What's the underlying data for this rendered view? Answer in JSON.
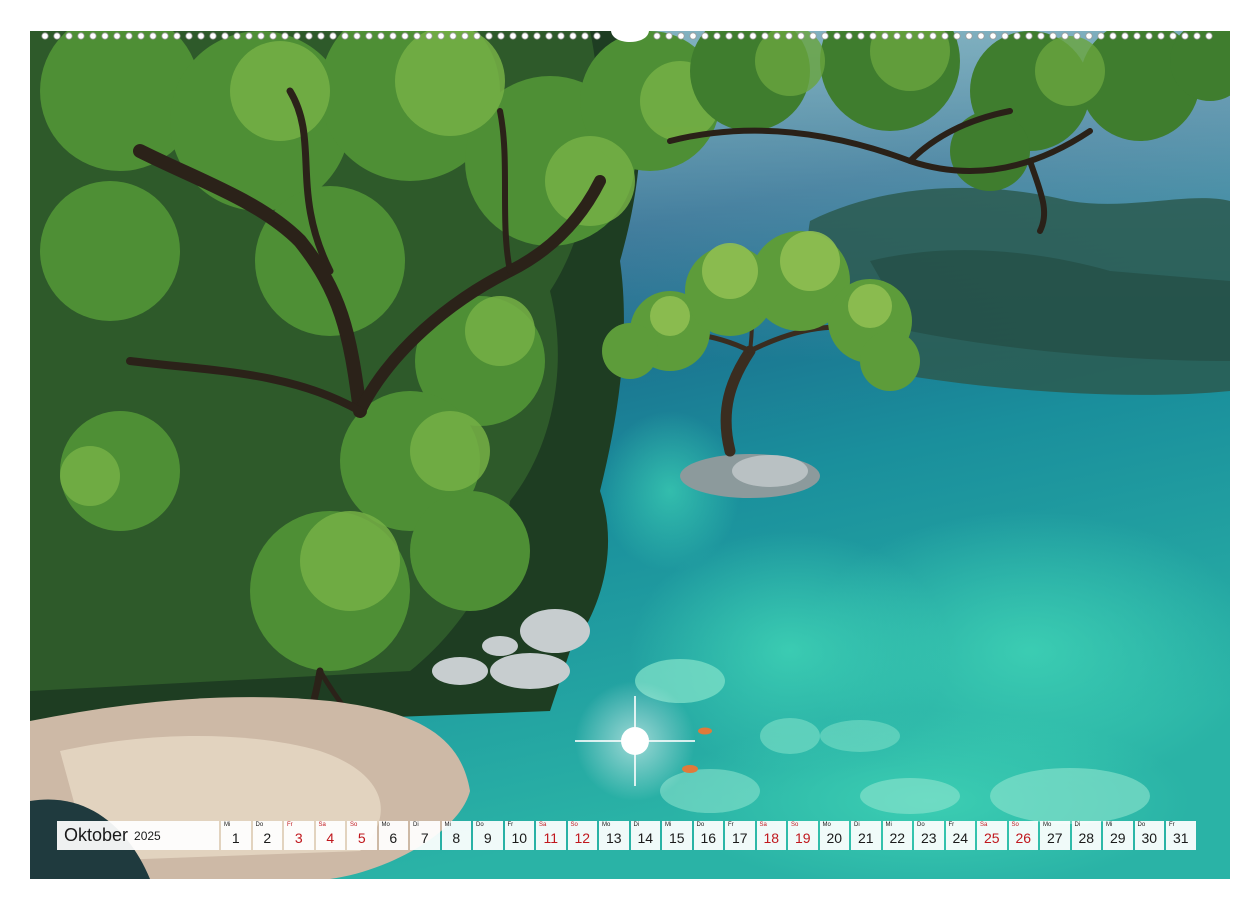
{
  "calendar": {
    "month": "Oktober",
    "year": "2025",
    "colors": {
      "weekend": "#c0171d",
      "text": "#1a1a1a"
    },
    "days": [
      {
        "weekday": "Mi",
        "day": "1",
        "red": false
      },
      {
        "weekday": "Do",
        "day": "2",
        "red": false
      },
      {
        "weekday": "Fr",
        "day": "3",
        "red": true
      },
      {
        "weekday": "Sa",
        "day": "4",
        "red": true
      },
      {
        "weekday": "So",
        "day": "5",
        "red": true
      },
      {
        "weekday": "Mo",
        "day": "6",
        "red": false
      },
      {
        "weekday": "Di",
        "day": "7",
        "red": false
      },
      {
        "weekday": "Mi",
        "day": "8",
        "red": false
      },
      {
        "weekday": "Do",
        "day": "9",
        "red": false
      },
      {
        "weekday": "Fr",
        "day": "10",
        "red": false
      },
      {
        "weekday": "Sa",
        "day": "11",
        "red": true
      },
      {
        "weekday": "So",
        "day": "12",
        "red": true
      },
      {
        "weekday": "Mo",
        "day": "13",
        "red": false
      },
      {
        "weekday": "Di",
        "day": "14",
        "red": false
      },
      {
        "weekday": "Mi",
        "day": "15",
        "red": false
      },
      {
        "weekday": "Do",
        "day": "16",
        "red": false
      },
      {
        "weekday": "Fr",
        "day": "17",
        "red": false
      },
      {
        "weekday": "Sa",
        "day": "18",
        "red": true
      },
      {
        "weekday": "So",
        "day": "19",
        "red": true
      },
      {
        "weekday": "Mo",
        "day": "20",
        "red": false
      },
      {
        "weekday": "Di",
        "day": "21",
        "red": false
      },
      {
        "weekday": "Mi",
        "day": "22",
        "red": false
      },
      {
        "weekday": "Do",
        "day": "23",
        "red": false
      },
      {
        "weekday": "Fr",
        "day": "24",
        "red": false
      },
      {
        "weekday": "Sa",
        "day": "25",
        "red": true
      },
      {
        "weekday": "So",
        "day": "26",
        "red": true
      },
      {
        "weekday": "Mo",
        "day": "27",
        "red": false
      },
      {
        "weekday": "Di",
        "day": "28",
        "red": false
      },
      {
        "weekday": "Mi",
        "day": "29",
        "red": false
      },
      {
        "weekday": "Do",
        "day": "30",
        "red": false
      },
      {
        "weekday": "Fr",
        "day": "31",
        "red": false
      }
    ]
  }
}
